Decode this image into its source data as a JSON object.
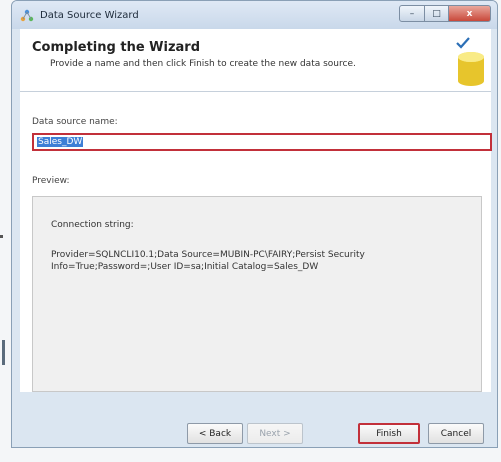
{
  "window": {
    "title": "Data Source Wizard",
    "controls": {
      "minimize": "–",
      "maximize": "□",
      "close": "x"
    }
  },
  "header": {
    "heading": "Completing the Wizard",
    "subheading": "Provide a name and then click Finish to create the new data source.",
    "icon": "database-icon"
  },
  "form": {
    "name_label": "Data source name:",
    "name_value": "Sales_DW",
    "preview_label": "Preview:",
    "connection_label": "Connection string:",
    "connection_value": "Provider=SQLNCLI10.1;Data Source=MUBIN-PC\\FAIRY;Persist Security Info=True;Password=;User ID=sa;Initial Catalog=Sales_DW"
  },
  "footer": {
    "back_label": "< Back",
    "next_label": "Next >",
    "finish_label": "Finish",
    "cancel_label": "Cancel"
  },
  "colors": {
    "highlight_border": "#c2303a",
    "selection": "#3d7fd6",
    "window_frame": "#dbe6f1"
  }
}
